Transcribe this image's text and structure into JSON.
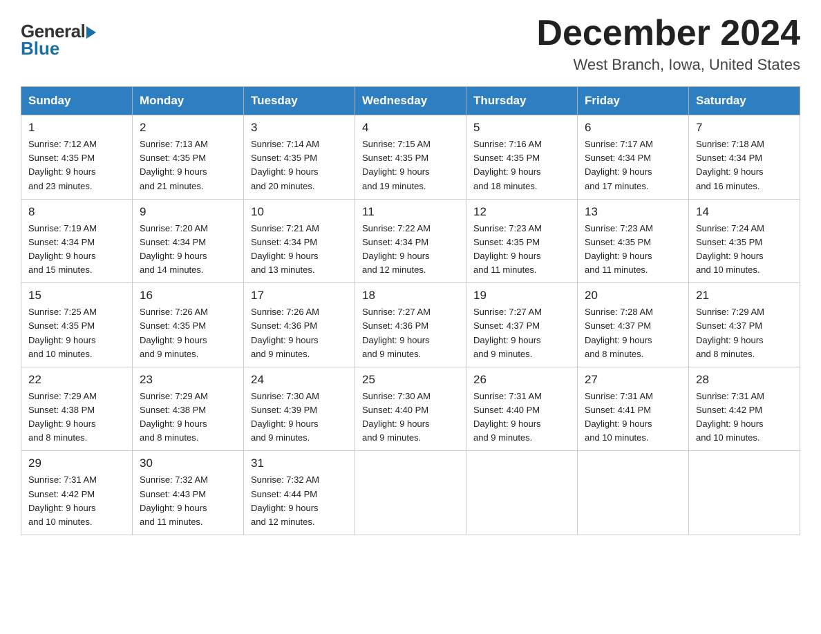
{
  "logo": {
    "general": "General",
    "blue": "Blue"
  },
  "title": "December 2024",
  "location": "West Branch, Iowa, United States",
  "days_of_week": [
    "Sunday",
    "Monday",
    "Tuesday",
    "Wednesday",
    "Thursday",
    "Friday",
    "Saturday"
  ],
  "weeks": [
    [
      {
        "day": "1",
        "sunrise": "7:12 AM",
        "sunset": "4:35 PM",
        "daylight": "9 hours and 23 minutes."
      },
      {
        "day": "2",
        "sunrise": "7:13 AM",
        "sunset": "4:35 PM",
        "daylight": "9 hours and 21 minutes."
      },
      {
        "day": "3",
        "sunrise": "7:14 AM",
        "sunset": "4:35 PM",
        "daylight": "9 hours and 20 minutes."
      },
      {
        "day": "4",
        "sunrise": "7:15 AM",
        "sunset": "4:35 PM",
        "daylight": "9 hours and 19 minutes."
      },
      {
        "day": "5",
        "sunrise": "7:16 AM",
        "sunset": "4:35 PM",
        "daylight": "9 hours and 18 minutes."
      },
      {
        "day": "6",
        "sunrise": "7:17 AM",
        "sunset": "4:34 PM",
        "daylight": "9 hours and 17 minutes."
      },
      {
        "day": "7",
        "sunrise": "7:18 AM",
        "sunset": "4:34 PM",
        "daylight": "9 hours and 16 minutes."
      }
    ],
    [
      {
        "day": "8",
        "sunrise": "7:19 AM",
        "sunset": "4:34 PM",
        "daylight": "9 hours and 15 minutes."
      },
      {
        "day": "9",
        "sunrise": "7:20 AM",
        "sunset": "4:34 PM",
        "daylight": "9 hours and 14 minutes."
      },
      {
        "day": "10",
        "sunrise": "7:21 AM",
        "sunset": "4:34 PM",
        "daylight": "9 hours and 13 minutes."
      },
      {
        "day": "11",
        "sunrise": "7:22 AM",
        "sunset": "4:34 PM",
        "daylight": "9 hours and 12 minutes."
      },
      {
        "day": "12",
        "sunrise": "7:23 AM",
        "sunset": "4:35 PM",
        "daylight": "9 hours and 11 minutes."
      },
      {
        "day": "13",
        "sunrise": "7:23 AM",
        "sunset": "4:35 PM",
        "daylight": "9 hours and 11 minutes."
      },
      {
        "day": "14",
        "sunrise": "7:24 AM",
        "sunset": "4:35 PM",
        "daylight": "9 hours and 10 minutes."
      }
    ],
    [
      {
        "day": "15",
        "sunrise": "7:25 AM",
        "sunset": "4:35 PM",
        "daylight": "9 hours and 10 minutes."
      },
      {
        "day": "16",
        "sunrise": "7:26 AM",
        "sunset": "4:35 PM",
        "daylight": "9 hours and 9 minutes."
      },
      {
        "day": "17",
        "sunrise": "7:26 AM",
        "sunset": "4:36 PM",
        "daylight": "9 hours and 9 minutes."
      },
      {
        "day": "18",
        "sunrise": "7:27 AM",
        "sunset": "4:36 PM",
        "daylight": "9 hours and 9 minutes."
      },
      {
        "day": "19",
        "sunrise": "7:27 AM",
        "sunset": "4:37 PM",
        "daylight": "9 hours and 9 minutes."
      },
      {
        "day": "20",
        "sunrise": "7:28 AM",
        "sunset": "4:37 PM",
        "daylight": "9 hours and 8 minutes."
      },
      {
        "day": "21",
        "sunrise": "7:29 AM",
        "sunset": "4:37 PM",
        "daylight": "9 hours and 8 minutes."
      }
    ],
    [
      {
        "day": "22",
        "sunrise": "7:29 AM",
        "sunset": "4:38 PM",
        "daylight": "9 hours and 8 minutes."
      },
      {
        "day": "23",
        "sunrise": "7:29 AM",
        "sunset": "4:38 PM",
        "daylight": "9 hours and 8 minutes."
      },
      {
        "day": "24",
        "sunrise": "7:30 AM",
        "sunset": "4:39 PM",
        "daylight": "9 hours and 9 minutes."
      },
      {
        "day": "25",
        "sunrise": "7:30 AM",
        "sunset": "4:40 PM",
        "daylight": "9 hours and 9 minutes."
      },
      {
        "day": "26",
        "sunrise": "7:31 AM",
        "sunset": "4:40 PM",
        "daylight": "9 hours and 9 minutes."
      },
      {
        "day": "27",
        "sunrise": "7:31 AM",
        "sunset": "4:41 PM",
        "daylight": "9 hours and 10 minutes."
      },
      {
        "day": "28",
        "sunrise": "7:31 AM",
        "sunset": "4:42 PM",
        "daylight": "9 hours and 10 minutes."
      }
    ],
    [
      {
        "day": "29",
        "sunrise": "7:31 AM",
        "sunset": "4:42 PM",
        "daylight": "9 hours and 10 minutes."
      },
      {
        "day": "30",
        "sunrise": "7:32 AM",
        "sunset": "4:43 PM",
        "daylight": "9 hours and 11 minutes."
      },
      {
        "day": "31",
        "sunrise": "7:32 AM",
        "sunset": "4:44 PM",
        "daylight": "9 hours and 12 minutes."
      },
      null,
      null,
      null,
      null
    ]
  ]
}
